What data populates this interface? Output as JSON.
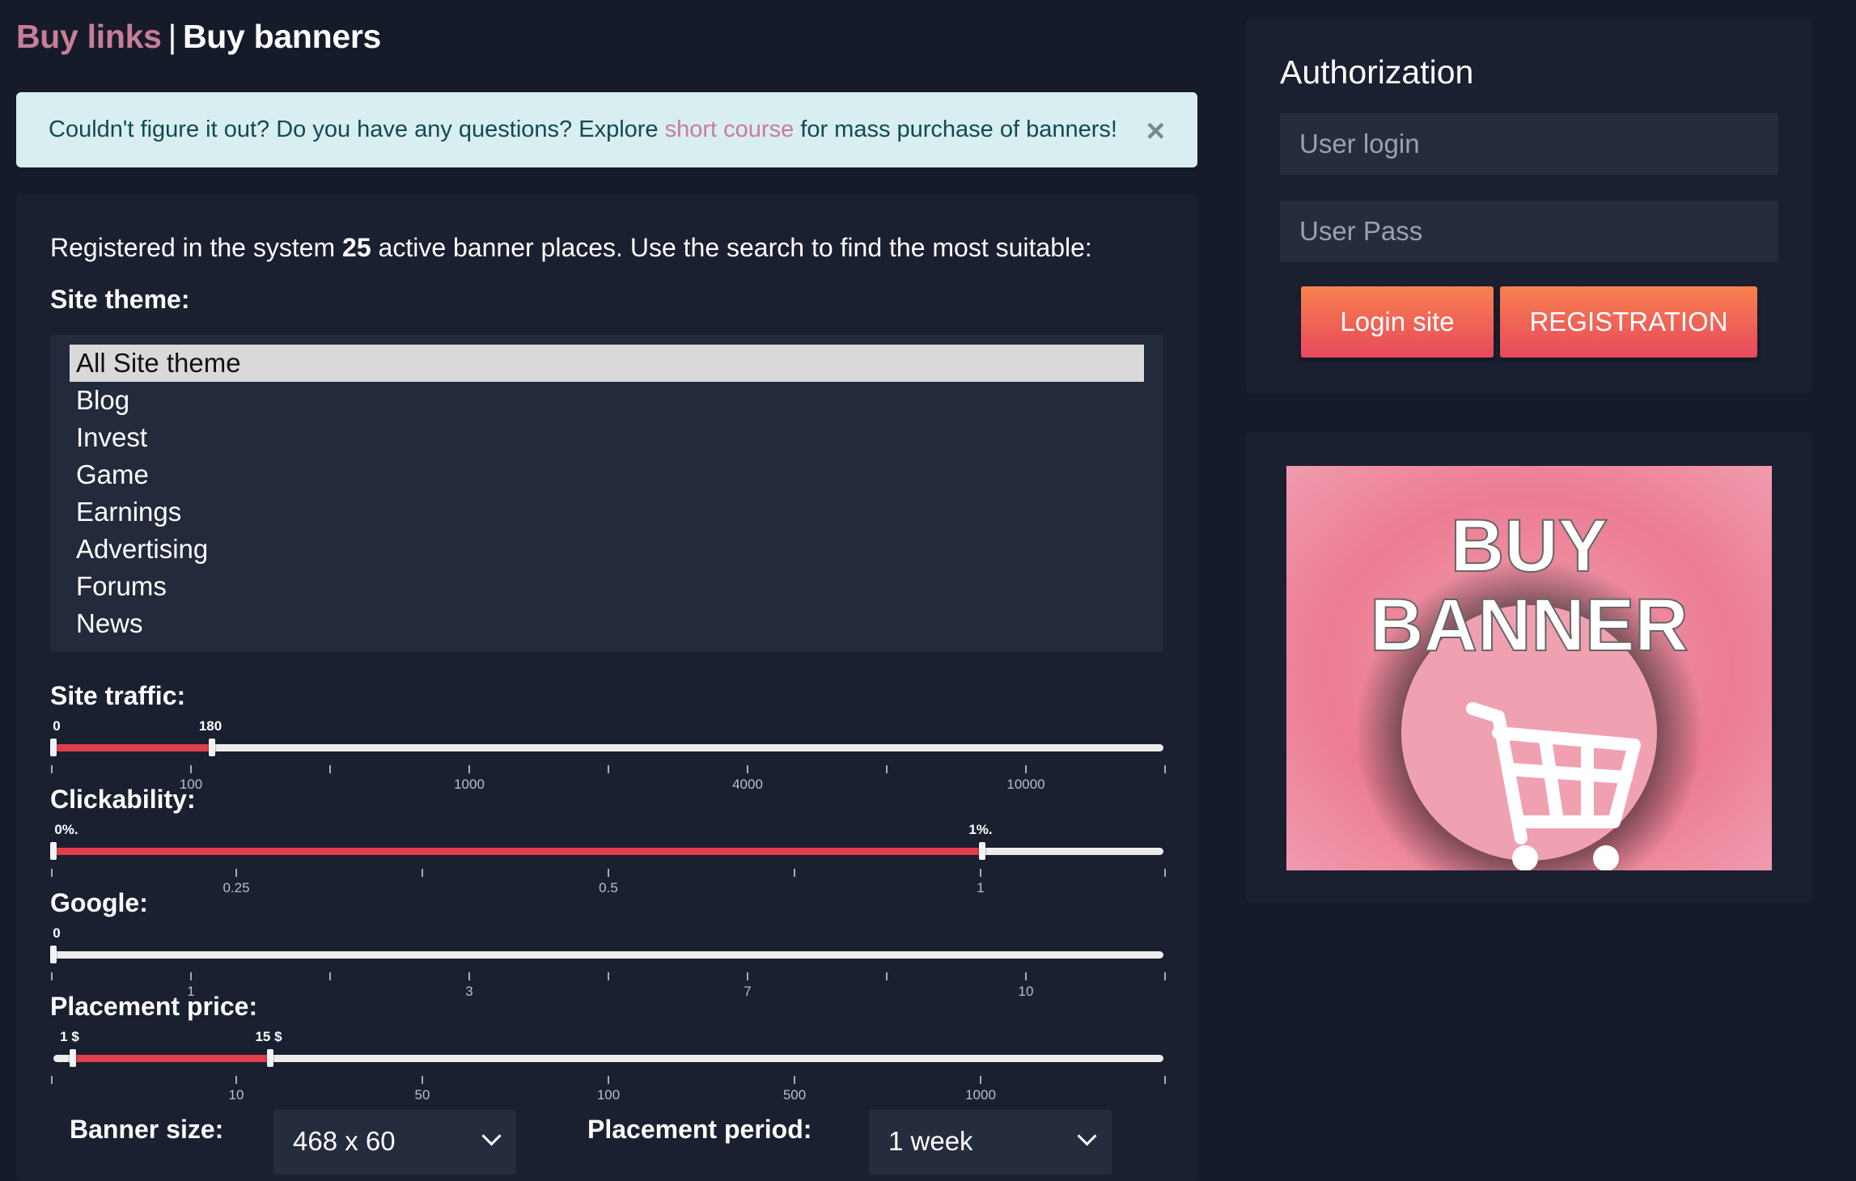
{
  "header": {
    "link_label": "Buy links",
    "separator": "|",
    "current_label": "Buy banners",
    "link_color": "#c97d97"
  },
  "alert": {
    "text_before": "Couldn't figure it out? Do you have any questions? Explore ",
    "link_text": "short course",
    "text_after": " for mass purchase of banners!",
    "close_symbol": "×"
  },
  "filters": {
    "intro_before": "Registered in the system ",
    "active_count": "25",
    "intro_after": " active banner places. Use the search to find the most suitable:",
    "site_theme": {
      "label": "Site theme:",
      "selected": "All Site theme",
      "options": [
        "All Site theme",
        "Blog",
        "Invest",
        "Game",
        "Earnings",
        "Advertising",
        "Forums",
        "News"
      ]
    },
    "site_traffic": {
      "label": "Site traffic:",
      "from_label": "0",
      "to_label": "180",
      "ticks": [
        "100",
        "1000",
        "4000",
        "10000"
      ]
    },
    "clickability": {
      "label": "Clickability:",
      "from_label": "0%.",
      "to_label": "1%.",
      "ticks": [
        "0.25",
        "0.5",
        "1"
      ]
    },
    "google": {
      "label": "Google:",
      "from_label": "0",
      "ticks": [
        "1",
        "3",
        "7",
        "10"
      ]
    },
    "placement_price": {
      "label": "Placement price:",
      "from_label": "1 $",
      "to_label": "15 $",
      "ticks": [
        "10",
        "50",
        "100",
        "500",
        "1000"
      ]
    },
    "banner_size": {
      "label": "Banner size:",
      "value": "468 x 60"
    },
    "placement_period": {
      "label": "Placement period:",
      "value": "1 week"
    }
  },
  "auth": {
    "title": "Authorization",
    "login_placeholder": "User login",
    "pass_placeholder": "User Pass",
    "login_button": "Login site",
    "register_button": "REGISTRATION"
  },
  "promo": {
    "line1": "BUY",
    "line2": "BANNER",
    "icon": "shopping-cart-icon"
  },
  "colors": {
    "background": "#161b2a",
    "panel": "#1a2030",
    "slider_fill": "#e03e4f",
    "button_gradient_top": "#f7814e",
    "button_gradient_bottom": "#e8495e"
  }
}
